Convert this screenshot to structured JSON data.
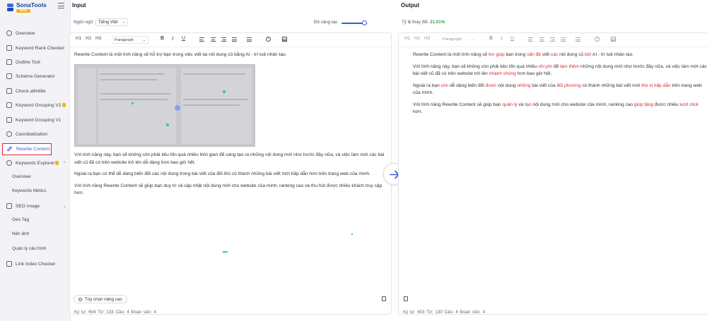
{
  "brand": {
    "name": "SonaTools",
    "badge": "Beta"
  },
  "sidebar": {
    "items": [
      {
        "label": "Overview"
      },
      {
        "label": "Keyword Rank Checker"
      },
      {
        "label": "Outline Tool"
      },
      {
        "label": "Schema Generator"
      },
      {
        "label": "Check allintitle"
      },
      {
        "label": "Keyword Grouping V2"
      },
      {
        "label": "Keyword Grouping V1"
      },
      {
        "label": "Cannibalization"
      },
      {
        "label": "Rewrite Content"
      },
      {
        "label": "Keywords Explorer"
      },
      {
        "label": "SEO Image"
      },
      {
        "label": "Link Index Checker"
      }
    ],
    "keywords_sub": [
      "Overview",
      "Keywords Metics"
    ],
    "seo_image_sub": [
      "Geo Tag",
      "Nén ảnh",
      "Quản lý cấu hình"
    ]
  },
  "input": {
    "title": "Input",
    "language_label": "Ngôn ngữ",
    "language_value": "Tiếng Việt",
    "creativity_label": "Độ sáng tạo",
    "creativity_level": 0.8,
    "toolbar": {
      "h1": "H1",
      "h2": "H2",
      "h3": "H3",
      "paragraph": "Paragraph",
      "bold": "B",
      "italic": "I",
      "underline": "U",
      "help": "?"
    },
    "paragraphs": [
      "Rewrite Content là một tính năng sẽ hỗ trợ bạn trong việc viết lại nội dung cũ bằng AI - trí tuệ nhân tạo.",
      "Với tính năng này, bạn sẽ không còn phải tiêu tốn quá nhiều thời gian để sáng tạo ra những nội dung mới như trước đây nữa, và việc làm mới các bài viết cũ đã có trên website trở lên dễ dàng hơn bao giờ hết.",
      "Ngoài ra bạn có thể dễ dàng biến đổi các nội dung trong bài viết của đối thủ có thành những bài viết mới hấp dẫn hơn trên trang web của mình.",
      "Với tính năng Rewrite Content sẽ giúp bạn duy trì và cập nhật nội dung mới cho website của mình, ranking cao và thu hút được nhiều khách truy cập hơn."
    ],
    "advanced_button": "Tùy chọn nâng cao",
    "stats": "Ký tự: 604   Từ: 133   Câu: 4   Đoạn văn: 4"
  },
  "output": {
    "title": "Output",
    "change_label": "Tỷ lệ thay đổi:",
    "change_value": "21.01%",
    "toolbar": {
      "h1": "H1",
      "h2": "H2",
      "h3": "H3",
      "paragraph": "Paragraph",
      "bold": "B",
      "italic": "I",
      "underline": "U",
      "help": "?"
    },
    "p1": {
      "a": "Rewrite Content là một tính năng sẽ ",
      "h1": "trợ giúp",
      "b": " bạn trong ",
      "h2": "vấn đề",
      "c": " viết ",
      "h3": "các",
      "d": " nội dung cũ ",
      "h4": "bởi",
      "e": " AI - trí tuệ nhân tạo."
    },
    "p2": {
      "a": "Với tính năng này, bạn sẽ không còn phải tiêu tốn quá nhiều ",
      "h1": "chi phí",
      "b": " để ",
      "h2": "làm thêm",
      "c": " những nội dung mới như trước đây nữa, và việc làm mới các bài viết cũ đã có trên website trở lên ",
      "h3": "nhanh chóng",
      "d": " hơn bao giờ hết."
    },
    "p3": {
      "a": "Ngoài ra bạn ",
      "h1": "còn",
      "b": " dễ dàng biến đổi ",
      "h2": "được",
      "c": " nội dung ",
      "h3": "những",
      "d": " bài viết của ",
      "h4": "đối phương",
      "e": " có thành những bài viết mới ",
      "h5": "thú vị hấp dẫn",
      "f": " trên trang web của mình."
    },
    "p4": {
      "a": "Với tính năng Rewrite Content sẽ giúp bạn ",
      "h1": "quản lý",
      "b": " và ",
      "h2": "tạo",
      "c": " nội dung mới cho website của mình, ranking cao ",
      "h3": "giúp tăng",
      "d": " được nhiều ",
      "h4": "lượt click",
      "e": " hơn."
    },
    "stats": "Ký tự: 603   Từ: 130   Câu: 4   Đoạn văn: 4"
  },
  "colors": {
    "accent": "#2f5fd8",
    "highlight": "#d9262e",
    "change": "#2ea84f",
    "active_border": "#d9262e"
  },
  "icons": {
    "convert": "arrow-right-icon",
    "menu": "hamburger-icon"
  }
}
